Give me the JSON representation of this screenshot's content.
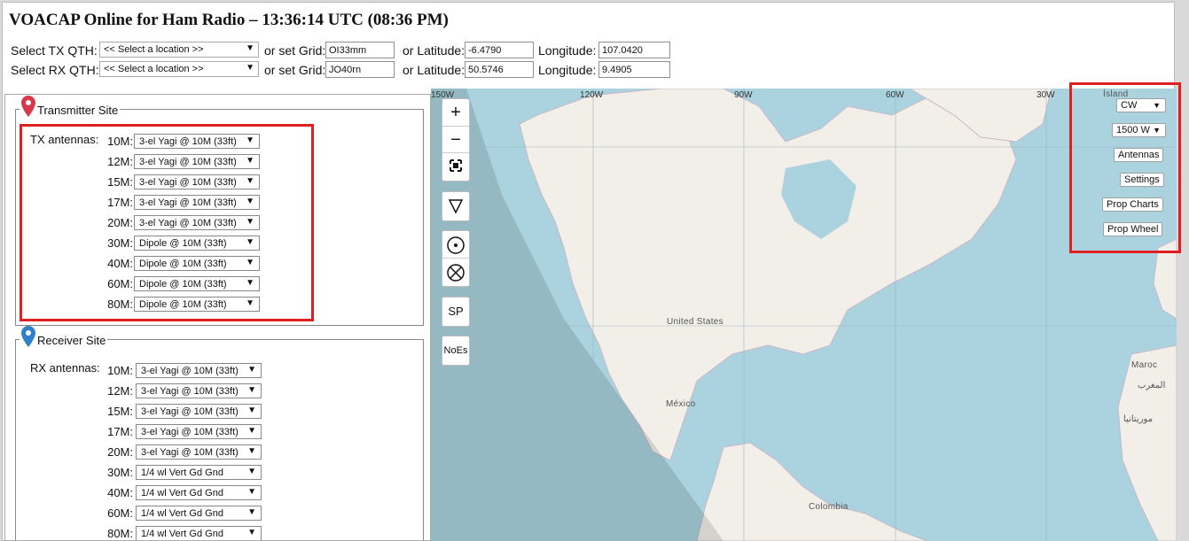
{
  "title": "VOACAP Online for Ham Radio – 13:36:14 UTC (08:36 PM)",
  "tx_qth": {
    "label": "Select TX QTH:",
    "location_select": "<< Select a location >>",
    "grid_label": "or set Grid:",
    "grid": "OI33mm",
    "lat_label": "or Latitude:",
    "latitude": "-6.4790",
    "lon_label": "Longitude:",
    "longitude": "107.0420"
  },
  "rx_qth": {
    "label": "Select RX QTH:",
    "location_select": "<< Select a location >>",
    "grid_label": "or set Grid:",
    "grid": "JO40rn",
    "lat_label": "or Latitude:",
    "latitude": "50.5746",
    "lon_label": "Longitude:",
    "longitude": "9.4905"
  },
  "transmitter": {
    "legend": "Transmitter Site",
    "antennas_label": "TX antennas:",
    "antennas": [
      {
        "band": "10M:",
        "antenna": "3-el Yagi @ 10M (33ft)"
      },
      {
        "band": "12M:",
        "antenna": "3-el Yagi @ 10M (33ft)"
      },
      {
        "band": "15M:",
        "antenna": "3-el Yagi @ 10M (33ft)"
      },
      {
        "band": "17M:",
        "antenna": "3-el Yagi @ 10M (33ft)"
      },
      {
        "band": "20M:",
        "antenna": "3-el Yagi @ 10M (33ft)"
      },
      {
        "band": "30M:",
        "antenna": "Dipole @ 10M (33ft)"
      },
      {
        "band": "40M:",
        "antenna": "Dipole @ 10M (33ft)"
      },
      {
        "band": "60M:",
        "antenna": "Dipole @ 10M (33ft)"
      },
      {
        "band": "80M:",
        "antenna": "Dipole @ 10M (33ft)"
      }
    ]
  },
  "receiver": {
    "legend": "Receiver Site",
    "antennas_label": "RX antennas:",
    "antennas": [
      {
        "band": "10M:",
        "antenna": "3-el Yagi @ 10M (33ft)"
      },
      {
        "band": "12M:",
        "antenna": "3-el Yagi @ 10M (33ft)"
      },
      {
        "band": "15M:",
        "antenna": "3-el Yagi @ 10M (33ft)"
      },
      {
        "band": "17M:",
        "antenna": "3-el Yagi @ 10M (33ft)"
      },
      {
        "band": "20M:",
        "antenna": "3-el Yagi @ 10M (33ft)"
      },
      {
        "band": "30M:",
        "antenna": "1/4 wl Vert Gd Gnd"
      },
      {
        "band": "40M:",
        "antenna": "1/4 wl Vert Gd Gnd"
      },
      {
        "band": "60M:",
        "antenna": "1/4 wl Vert Gd Gnd"
      },
      {
        "band": "80M:",
        "antenna": "1/4 wl Vert Gd Gnd"
      }
    ]
  },
  "map": {
    "zoom_in": "+",
    "zoom_out": "−",
    "sp_button": "SP",
    "noes_button": "NoEs",
    "longitude_labels": [
      "150W",
      "120W",
      "90W",
      "60W",
      "30W"
    ],
    "places": {
      "us": "United States",
      "mexico": "México",
      "colombia": "Colombia",
      "island": "Ísland",
      "morocco": "Maroc",
      "morocco_ar": "المغرب",
      "mauritania_ar": "موريتانيا"
    }
  },
  "controls": {
    "mode": "CW",
    "power": "1500 W",
    "antennas_button": "Antennas",
    "settings_button": "Settings",
    "prop_charts_button": "Prop Charts",
    "prop_wheel_button": "Prop Wheel"
  },
  "colors": {
    "highlight_border": "#e02020",
    "water": "#aad3df",
    "land": "#f2efe9"
  }
}
